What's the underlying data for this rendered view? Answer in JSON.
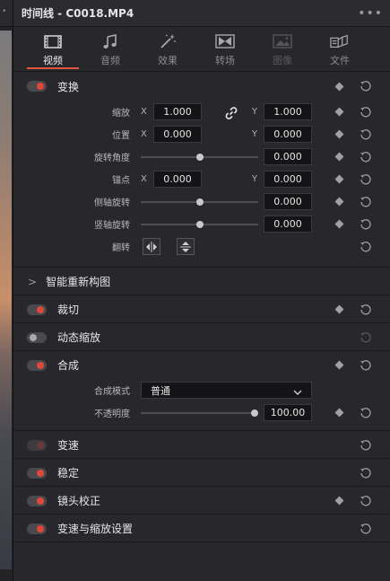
{
  "left_strip": {
    "glyph": "•"
  },
  "header": {
    "title": "时间线 - C0018.MP4",
    "more_glyph": "•••"
  },
  "tabs": [
    {
      "label": "视频",
      "icon": "film-strip-icon",
      "active": true
    },
    {
      "label": "音频",
      "icon": "music-note-icon",
      "active": false
    },
    {
      "label": "效果",
      "icon": "magic-wand-icon",
      "active": false
    },
    {
      "label": "转场",
      "icon": "transition-icon",
      "active": false
    },
    {
      "label": "图像",
      "icon": "image-icon",
      "active": false,
      "disabled": true
    },
    {
      "label": "文件",
      "icon": "file-icon",
      "active": false
    }
  ],
  "transform": {
    "title": "变换",
    "zoom": {
      "label": "缩放",
      "x_axis": "X",
      "x": "1.000",
      "y_axis": "Y",
      "y": "1.000"
    },
    "position": {
      "label": "位置",
      "x_axis": "X",
      "x": "0.000",
      "y_axis": "Y",
      "y": "0.000"
    },
    "rotation": {
      "label": "旋转角度",
      "value": "0.000",
      "slider_fraction": 0.5
    },
    "anchor": {
      "label": "锚点",
      "x_axis": "X",
      "x": "0.000",
      "y_axis": "Y",
      "y": "0.000"
    },
    "pitch": {
      "label": "侧轴旋转",
      "value": "0.000",
      "slider_fraction": 0.5
    },
    "yaw": {
      "label": "竖轴旋转",
      "value": "0.000",
      "slider_fraction": 0.5
    },
    "flip": {
      "label": "翻转"
    }
  },
  "smart_reframe": {
    "title": "智能重新构图",
    "caret": ">"
  },
  "crop": {
    "title": "裁切"
  },
  "dynamic_zoom": {
    "title": "动态缩放"
  },
  "composite": {
    "title": "合成",
    "mode": {
      "label": "合成模式",
      "value": "普通"
    },
    "opacity": {
      "label": "不透明度",
      "value": "100.00",
      "slider_fraction": 1.0
    }
  },
  "speed_change": {
    "title": "变速"
  },
  "stabilization": {
    "title": "稳定"
  },
  "lens_correction": {
    "title": "镜头校正"
  },
  "retime_scaling": {
    "title": "变速与缩放设置"
  },
  "colors": {
    "accent": "#e0573f",
    "toggle_on": "#e0463a",
    "panel_bg": "#28282c",
    "field_bg": "#141416"
  }
}
